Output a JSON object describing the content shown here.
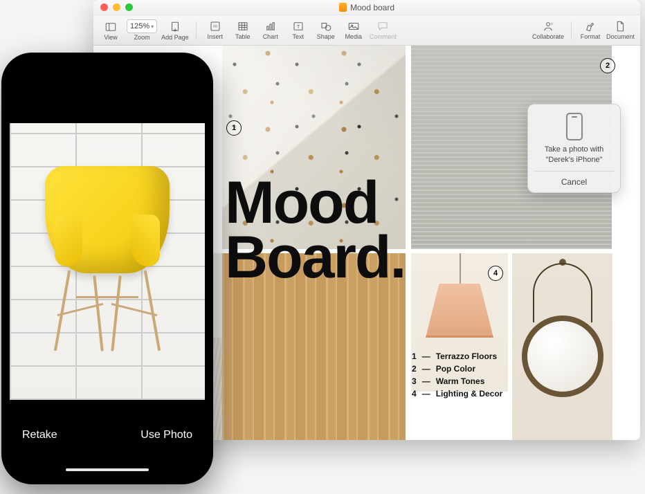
{
  "window": {
    "title": "Mood board",
    "traffic": [
      "close",
      "minimize",
      "zoom"
    ]
  },
  "toolbar": {
    "view": "View",
    "zoom_label": "Zoom",
    "zoom_value": "125%",
    "add_page": "Add Page",
    "insert": "Insert",
    "table": "Table",
    "chart": "Chart",
    "text": "Text",
    "shape": "Shape",
    "media": "Media",
    "comment": "Comment",
    "collaborate": "Collaborate",
    "format": "Format",
    "document": "Document"
  },
  "moodboard": {
    "title_line1": "Mood",
    "title_line2": "Board.",
    "markers": {
      "1": "1",
      "2": "2",
      "4": "4"
    },
    "legend": [
      {
        "n": "1",
        "label": "Terrazzo Floors"
      },
      {
        "n": "2",
        "label": "Pop Color"
      },
      {
        "n": "3",
        "label": "Warm Tones"
      },
      {
        "n": "4",
        "label": "Lighting & Decor"
      }
    ]
  },
  "popover": {
    "line1": "Take a photo with",
    "line2": "\"Derek's iPhone\"",
    "cancel": "Cancel"
  },
  "iphone": {
    "retake": "Retake",
    "use_photo": "Use Photo"
  }
}
